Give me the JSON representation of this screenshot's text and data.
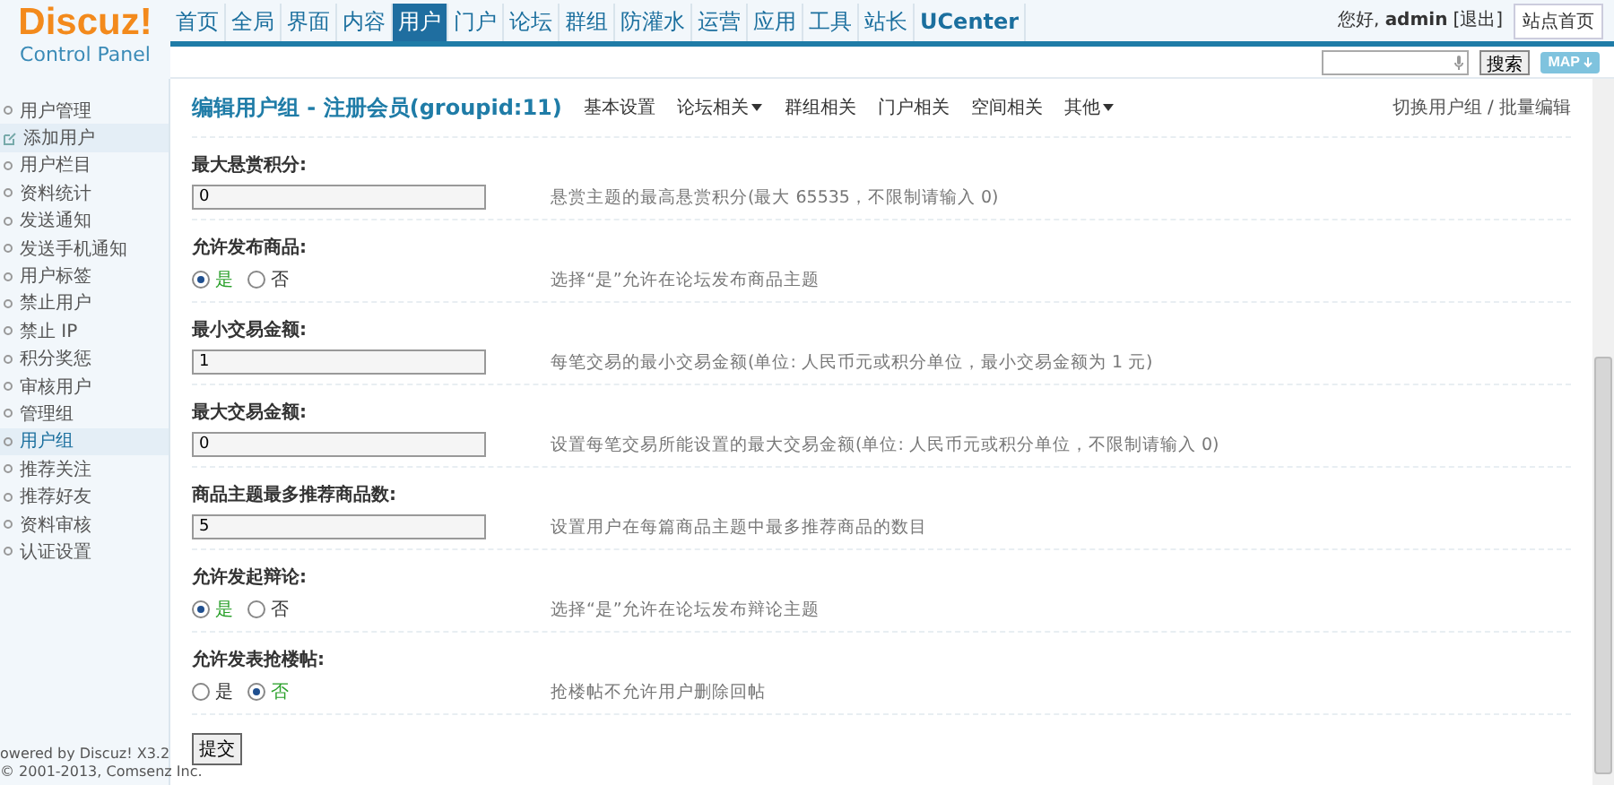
{
  "logo": {
    "title": "Discuz!",
    "subtitle": "Control Panel"
  },
  "nav": [
    {
      "label": "首页",
      "selected": false
    },
    {
      "label": "全局",
      "selected": false
    },
    {
      "label": "界面",
      "selected": false
    },
    {
      "label": "内容",
      "selected": false
    },
    {
      "label": "用户",
      "selected": true
    },
    {
      "label": "门户",
      "selected": false
    },
    {
      "label": "论坛",
      "selected": false
    },
    {
      "label": "群组",
      "selected": false
    },
    {
      "label": "防灌水",
      "selected": false
    },
    {
      "label": "运营",
      "selected": false
    },
    {
      "label": "应用",
      "selected": false
    },
    {
      "label": "工具",
      "selected": false
    },
    {
      "label": "站长",
      "selected": false
    },
    {
      "label": "UCenter",
      "selected": false
    }
  ],
  "user": {
    "greeting": "您好,",
    "name": "admin",
    "logout": "[退出]",
    "home": "站点首页"
  },
  "search": {
    "button": "搜索",
    "map": "MAP"
  },
  "sidebar": {
    "items": [
      {
        "label": "用户管理",
        "kind": "bullet",
        "selected": false
      },
      {
        "label": "添加用户",
        "kind": "shortcut",
        "selected": false
      },
      {
        "label": "用户栏目",
        "kind": "bullet",
        "selected": false
      },
      {
        "label": "资料统计",
        "kind": "bullet",
        "selected": false
      },
      {
        "label": "发送通知",
        "kind": "bullet",
        "selected": false
      },
      {
        "label": "发送手机通知",
        "kind": "bullet",
        "selected": false
      },
      {
        "label": "用户标签",
        "kind": "bullet",
        "selected": false
      },
      {
        "label": "禁止用户",
        "kind": "bullet",
        "selected": false
      },
      {
        "label": "禁止 IP",
        "kind": "bullet",
        "selected": false
      },
      {
        "label": "积分奖惩",
        "kind": "bullet",
        "selected": false
      },
      {
        "label": "审核用户",
        "kind": "bullet",
        "selected": false
      },
      {
        "label": "管理组",
        "kind": "bullet",
        "selected": false
      },
      {
        "label": "用户组",
        "kind": "bullet",
        "selected": true
      },
      {
        "label": "推荐关注",
        "kind": "bullet",
        "selected": false
      },
      {
        "label": "推荐好友",
        "kind": "bullet",
        "selected": false
      },
      {
        "label": "资料审核",
        "kind": "bullet",
        "selected": false
      },
      {
        "label": "认证设置",
        "kind": "bullet",
        "selected": false
      }
    ],
    "footer": [
      "owered by Discuz! X3.2",
      "© 2001-2013, Comsenz Inc."
    ]
  },
  "page": {
    "title": "编辑用户组 - 注册会员(groupid:11)",
    "tabs": [
      {
        "label": "基本设置",
        "menu": false
      },
      {
        "label": "论坛相关",
        "menu": true
      },
      {
        "label": "群组相关",
        "menu": false
      },
      {
        "label": "门户相关",
        "menu": false
      },
      {
        "label": "空间相关",
        "menu": false
      },
      {
        "label": "其他",
        "menu": true
      }
    ],
    "switch": "切换用户组 / 批量编辑"
  },
  "settings": [
    {
      "label": "最大悬赏积分:",
      "kind": "text",
      "value": "0",
      "hint": "悬赏主题的最高悬赏积分(最大 65535，不限制请输入 0)"
    },
    {
      "label": "允许发布商品:",
      "kind": "radio",
      "options": [
        {
          "label": "是",
          "selected": true
        },
        {
          "label": "否",
          "selected": false
        }
      ],
      "hint": "选择“是”允许在论坛发布商品主题"
    },
    {
      "label": "最小交易金额:",
      "kind": "text",
      "value": "1",
      "hint": "每笔交易的最小交易金额(单位: 人民币元或积分单位，最小交易金额为 1 元)"
    },
    {
      "label": "最大交易金额:",
      "kind": "text",
      "value": "0",
      "hint": "设置每笔交易所能设置的最大交易金额(单位: 人民币元或积分单位，不限制请输入 0)"
    },
    {
      "label": "商品主题最多推荐商品数:",
      "kind": "text",
      "value": "5",
      "hint": "设置用户在每篇商品主题中最多推荐商品的数目"
    },
    {
      "label": "允许发起辩论:",
      "kind": "radio",
      "options": [
        {
          "label": "是",
          "selected": true
        },
        {
          "label": "否",
          "selected": false
        }
      ],
      "hint": "选择“是”允许在论坛发布辩论主题"
    },
    {
      "label": "允许发表抢楼帖:",
      "kind": "radio",
      "options": [
        {
          "label": "是",
          "selected": false
        },
        {
          "label": "否",
          "selected": true
        }
      ],
      "hint": "抢楼帖不允许用户删除回帖"
    }
  ],
  "submit": "提交"
}
